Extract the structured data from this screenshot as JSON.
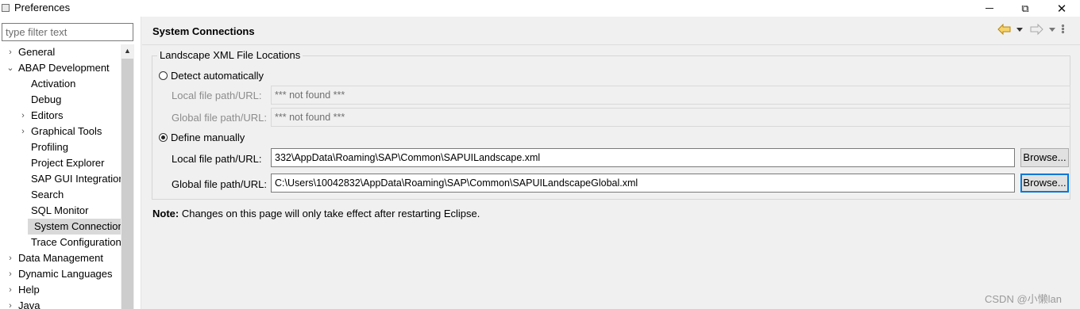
{
  "window": {
    "title": "Preferences",
    "minimize_glyph": "",
    "restore_glyph": "⧉",
    "close_glyph": "✕"
  },
  "filter": {
    "placeholder": "type filter text",
    "value": ""
  },
  "tree": {
    "items": [
      {
        "label": "General",
        "expand": "›",
        "level": 0
      },
      {
        "label": "ABAP Development",
        "expand": "⌄",
        "level": 0
      },
      {
        "label": "Activation",
        "expand": "",
        "level": 1
      },
      {
        "label": "Debug",
        "expand": "",
        "level": 1
      },
      {
        "label": "Editors",
        "expand": "›",
        "level": 1
      },
      {
        "label": "Graphical Tools",
        "expand": "›",
        "level": 1
      },
      {
        "label": "Profiling",
        "expand": "",
        "level": 1
      },
      {
        "label": "Project Explorer",
        "expand": "",
        "level": 1
      },
      {
        "label": "SAP GUI Integration",
        "expand": "",
        "level": 1
      },
      {
        "label": "Search",
        "expand": "",
        "level": 1
      },
      {
        "label": "SQL Monitor",
        "expand": "",
        "level": 1
      },
      {
        "label": "System Connections",
        "expand": "",
        "level": 1,
        "selected": true
      },
      {
        "label": "Trace Configurations",
        "expand": "",
        "level": 1
      },
      {
        "label": "Data Management",
        "expand": "›",
        "level": 0
      },
      {
        "label": "Dynamic Languages",
        "expand": "›",
        "level": 0
      },
      {
        "label": "Help",
        "expand": "›",
        "level": 0
      },
      {
        "label": "Java",
        "expand": "›",
        "level": 0
      }
    ],
    "scroll_up_glyph": "▲"
  },
  "page": {
    "title": "System Connections",
    "group_title": "Landscape XML File Locations",
    "detect_auto": {
      "label": "Detect automatically",
      "checked": false,
      "local_label": "Local file path/URL:",
      "local_value": "*** not found ***",
      "global_label": "Global file path/URL:",
      "global_value": "*** not found ***"
    },
    "define_manual": {
      "label": "Define manually",
      "checked": true,
      "local_label": "Local file path/URL:",
      "local_value": "332\\AppData\\Roaming\\SAP\\Common\\SAPUILandscape.xml",
      "global_label": "Global file path/URL:",
      "global_value": "C:\\Users\\10042832\\AppData\\Roaming\\SAP\\Common\\SAPUILandscapeGlobal.xml",
      "browse_label": "Browse..."
    },
    "note_bold": "Note:",
    "note_text": " Changes on this page will only take effect after restarting Eclipse."
  },
  "watermark": "CSDN @小懒lan",
  "colors": {
    "panel_bg": "#f0f0f0",
    "focus_blue": "#0078d7",
    "selected_bg": "#d9d9d9"
  },
  "icons": {
    "back": "back-arrow-icon",
    "forward": "forward-arrow-icon",
    "more": "vertical-dots-icon"
  }
}
